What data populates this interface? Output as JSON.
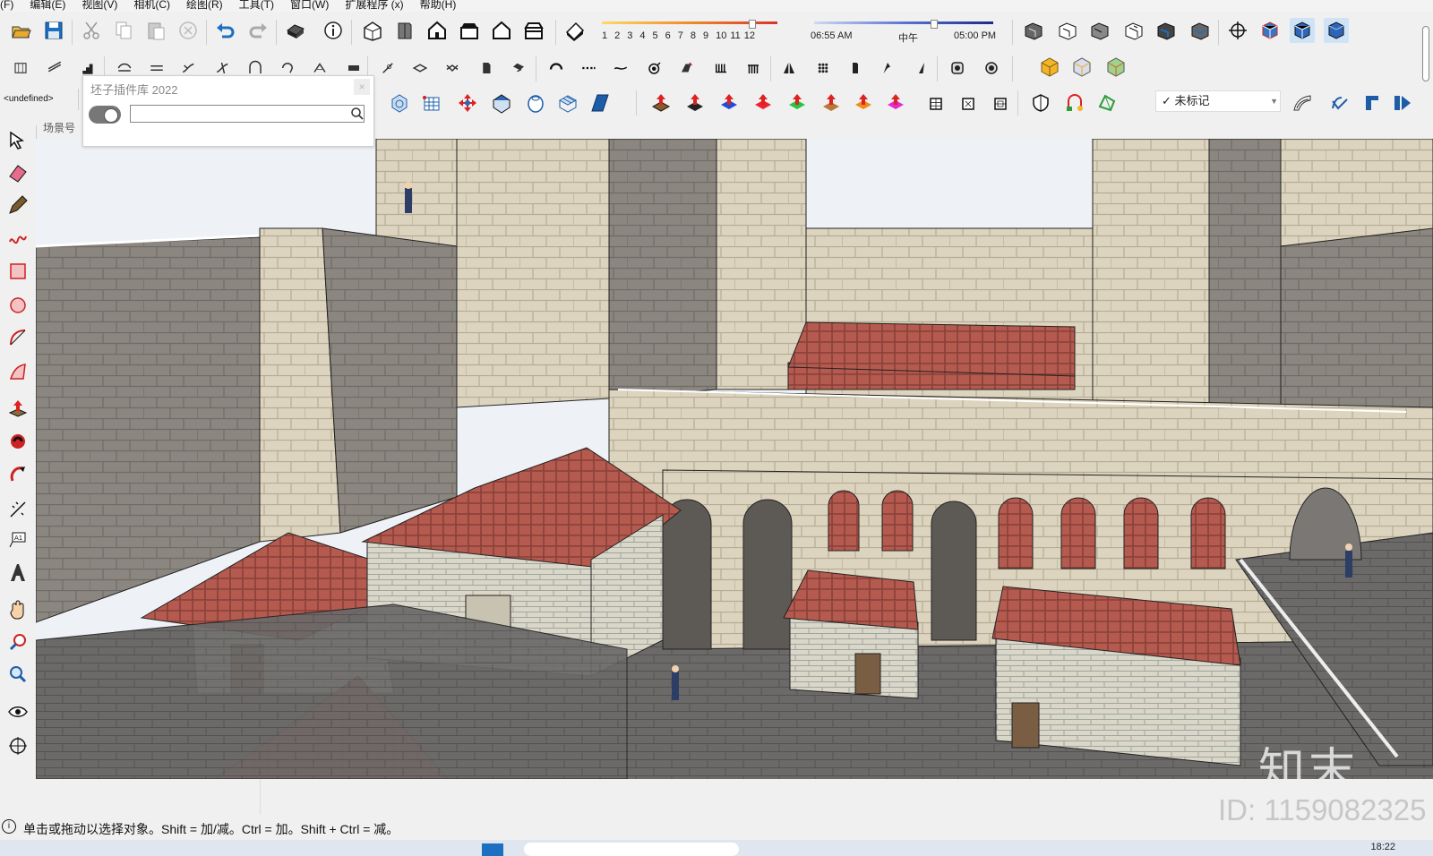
{
  "menu": [
    "(F)",
    "编辑(E)",
    "视图(V)",
    "相机(C)",
    "绘图(R)",
    "工具(T)",
    "窗口(W)",
    "扩展程序 (x)",
    "帮助(H)"
  ],
  "shadow": {
    "months": [
      "1",
      "2",
      "3",
      "4",
      "5",
      "6",
      "7",
      "8",
      "9",
      "10",
      "11",
      "12"
    ],
    "sunrise": "06:55 AM",
    "noon": "中午",
    "sunset": "05:00 PM"
  },
  "style_combo": "<undefined>",
  "tag_combo": {
    "check": "✓",
    "value": "未标记"
  },
  "plugin_panel": {
    "title": "坯子插件库 2022",
    "search_value": "",
    "close": "×"
  },
  "scene_tab": "场景号",
  "status": {
    "text": "单击或拖动以选择对象。Shift = 加/减。Ctrl = 加。Shift + Ctrl = 减。"
  },
  "watermark": {
    "brand": "知末",
    "id": "ID: 1159082325"
  },
  "clock": "18:22",
  "colors": {
    "wall": "#d9d1bd",
    "roof": "#b55a4f",
    "floor": "#6b6a69",
    "sky": "#eef1f5",
    "toolbar": "#f0f0f0"
  },
  "toolbar_row1_icons": [
    "open-icon",
    "save-icon",
    "cut-icon",
    "copy-icon",
    "paste-icon",
    "delete-icon",
    "undo-icon",
    "redo-icon",
    "print-icon",
    "model-info-icon",
    "iso-view-icon",
    "top-view-icon",
    "front-view-icon",
    "right-view-icon",
    "back-view-icon",
    "left-view-icon",
    "shadow-icon"
  ],
  "toolbar_row1_right_icons": [
    "section-1-icon",
    "section-2-icon",
    "section-3-icon",
    "section-4-icon",
    "section-5-icon",
    "section-6-icon",
    "axes-icon",
    "component-icon",
    "material-icon",
    "layer-icon"
  ],
  "toolbar_row2_icons": [
    "line-tool-icon",
    "array-icon",
    "stair-icon",
    "curve-1-icon",
    "curve-2-icon",
    "curve-3-icon",
    "curve-4-icon",
    "arc-icon",
    "weld-icon",
    "wall-icon",
    "grid-icon",
    "joint-icon",
    "fillet-icon",
    "chamfer-icon",
    "extrude-icon",
    "offset-icon",
    "wave-icon",
    "spiral-icon",
    "pipe-icon",
    "rail-icon",
    "fence-icon",
    "mirror-icon",
    "dots-icon",
    "column-icon",
    "pen-icon",
    "knife-icon",
    "camera-icon",
    "settings-icon",
    "cube-yellow-icon",
    "cube-gray-icon",
    "cube-green-icon"
  ],
  "toolbar_row3_icons": [
    "sphere-icon",
    "mesh-icon",
    "move-icon",
    "texture-icon",
    "ring-icon",
    "grid-3d-icon",
    "blue-plane-icon",
    "push-red-icon",
    "push-black-icon",
    "push-blue-icon",
    "push-red-2-icon",
    "push-green-icon",
    "push-red-3-icon",
    "push-orange-icon",
    "push-magenta-icon",
    "table-icon",
    "table-2-icon",
    "table-3-icon",
    "shield-icon",
    "trash-icon",
    "network-icon",
    "arch-icon",
    "pipe-tool-icon",
    "align-icon",
    "arrow-right-icon"
  ],
  "left_tools": [
    "orbit-icon",
    "eraser-icon",
    "pencil-icon",
    "freehand-icon",
    "rectangle-icon",
    "circle-icon",
    "arc-tool-icon",
    "polygon-icon",
    "push-pull-icon",
    "follow-me-icon",
    "rotate-icon",
    "tape-icon",
    "text-icon",
    "3d-text-icon",
    "pan-icon",
    "zoom-icon",
    "zoom-window-icon",
    "look-around-icon",
    "walk-icon"
  ]
}
